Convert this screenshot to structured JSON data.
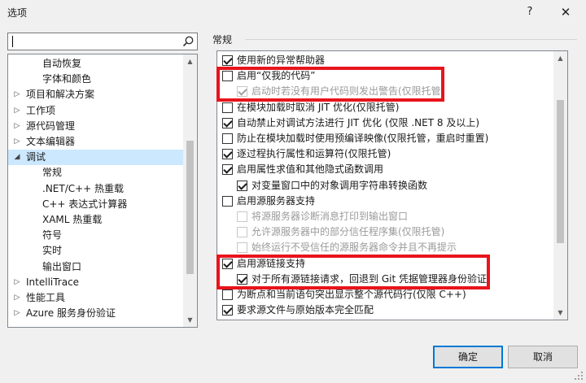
{
  "window": {
    "title": "选项",
    "help_glyph": "?",
    "close_glyph": "✕"
  },
  "search": {
    "value": "",
    "placeholder": "",
    "icon": "search-icon"
  },
  "tree": {
    "items": [
      {
        "label": "自动恢复",
        "level": 2,
        "expandable": false
      },
      {
        "label": "字体和颜色",
        "level": 2,
        "expandable": false
      },
      {
        "label": "项目和解决方案",
        "level": 1,
        "expandable": true,
        "expanded": false
      },
      {
        "label": "工作项",
        "level": 1,
        "expandable": true,
        "expanded": false
      },
      {
        "label": "源代码管理",
        "level": 1,
        "expandable": true,
        "expanded": false
      },
      {
        "label": "文本编辑器",
        "level": 1,
        "expandable": true,
        "expanded": false
      },
      {
        "label": "调试",
        "level": 1,
        "expandable": true,
        "expanded": true,
        "selected": true
      },
      {
        "label": "常规",
        "level": 2,
        "expandable": false
      },
      {
        "label": ".NET/C++ 热重载",
        "level": 2,
        "expandable": false
      },
      {
        "label": "C++ 表达式计算器",
        "level": 2,
        "expandable": false
      },
      {
        "label": "XAML 热重载",
        "level": 2,
        "expandable": false
      },
      {
        "label": "符号",
        "level": 2,
        "expandable": false
      },
      {
        "label": "实时",
        "level": 2,
        "expandable": false
      },
      {
        "label": "输出窗口",
        "level": 2,
        "expandable": false
      },
      {
        "label": "IntelliTrace",
        "level": 1,
        "expandable": true,
        "expanded": false
      },
      {
        "label": "性能工具",
        "level": 1,
        "expandable": true,
        "expanded": false
      },
      {
        "label": "Azure 服务身份验证",
        "level": 1,
        "expandable": true,
        "expanded": false
      }
    ]
  },
  "section": {
    "title": "常规"
  },
  "options": [
    {
      "label": "使用新的异常帮助器",
      "checked": true,
      "disabled": false,
      "indent": 0
    },
    {
      "label": "启用“仅我的代码”",
      "checked": false,
      "disabled": false,
      "indent": 0
    },
    {
      "label": "启动时若没有用户代码则发出警告(仅限托管)",
      "checked": true,
      "disabled": true,
      "indent": 1
    },
    {
      "label": "在模块加载时取消 JIT 优化(仅限托管)",
      "checked": false,
      "disabled": false,
      "indent": 0
    },
    {
      "label": "自动禁止对调试方法进行 JIT 优化 (仅限 .NET 8 及以上)",
      "checked": true,
      "disabled": false,
      "indent": 0
    },
    {
      "label": "防止在模块加载时使用预编译映像(仅限托管，重启时重置)",
      "checked": false,
      "disabled": false,
      "indent": 0
    },
    {
      "label": "逐过程执行属性和运算符(仅限托管)",
      "checked": true,
      "disabled": false,
      "indent": 0
    },
    {
      "label": "启用属性求值和其他隐式函数调用",
      "checked": true,
      "disabled": false,
      "indent": 0
    },
    {
      "label": "对变量窗口中的对象调用字符串转换函数",
      "checked": true,
      "disabled": false,
      "indent": 1
    },
    {
      "label": "启用源服务器支持",
      "checked": false,
      "disabled": false,
      "indent": 0
    },
    {
      "label": "将源服务器诊断消息打印到输出窗口",
      "checked": false,
      "disabled": true,
      "indent": 1
    },
    {
      "label": "允许源服务器中的部分信任程序集(仅限托管)",
      "checked": false,
      "disabled": true,
      "indent": 1
    },
    {
      "label": "始终运行不受信任的源服务器命令并且不再提示",
      "checked": false,
      "disabled": true,
      "indent": 1
    },
    {
      "label": "启用源链接支持",
      "checked": true,
      "disabled": false,
      "indent": 0
    },
    {
      "label": "对于所有源链接请求，回退到 Git 凭据管理器身份验证",
      "checked": true,
      "disabled": false,
      "indent": 1
    },
    {
      "label": "为断点和当前语句突出显示整个源代码行(仅限 C++)",
      "checked": false,
      "disabled": false,
      "indent": 0
    },
    {
      "label": "要求源文件与原始版本完全匹配",
      "checked": true,
      "disabled": false,
      "indent": 0
    }
  ],
  "buttons": {
    "ok": "确定",
    "cancel": "取消"
  },
  "colors": {
    "highlight": "#e8141c",
    "selection": "#cce8ff",
    "accent": "#0078d7"
  }
}
